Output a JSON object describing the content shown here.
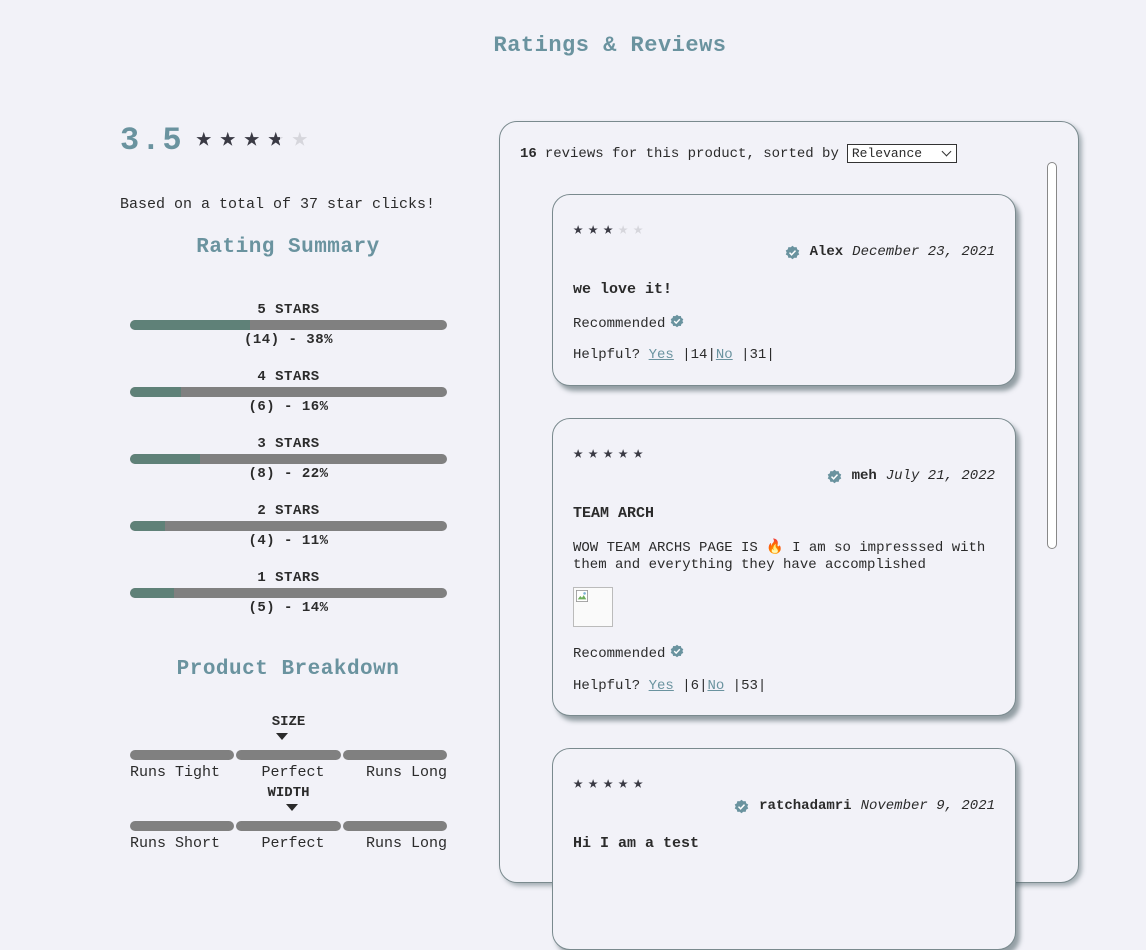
{
  "page": {
    "title": "Ratings & Reviews"
  },
  "summary": {
    "average": "3.5",
    "average_value": 3.5,
    "based_on": "Based on a total of 37 star clicks!",
    "title": "Rating Summary",
    "bars": [
      {
        "label": "5 STARS",
        "count": "(14) - 38%",
        "fraction": 0.38
      },
      {
        "label": "4 STARS",
        "count": "(6) - 16%",
        "fraction": 0.16
      },
      {
        "label": "3 STARS",
        "count": "(8) - 22%",
        "fraction": 0.22
      },
      {
        "label": "2 STARS",
        "count": "(4) - 11%",
        "fraction": 0.11
      },
      {
        "label": "1 STARS",
        "count": "(5) - 14%",
        "fraction": 0.14
      }
    ]
  },
  "breakdown": {
    "title": "Product Breakdown",
    "characteristics": [
      {
        "label": "SIZE",
        "low": "Runs Tight",
        "mid": "Perfect",
        "high": "Runs Long",
        "value": 0.48
      },
      {
        "label": "WIDTH",
        "low": "Runs Short",
        "mid": "Perfect",
        "high": "Runs Long",
        "value": 0.51
      }
    ]
  },
  "reviews": {
    "count": "16",
    "sort_text": "reviews for this product, sorted by",
    "sort_selected": "Relevance",
    "items": [
      {
        "rating": 3,
        "user": "Alex",
        "date": "December 23, 2021",
        "title": "we love it!",
        "body": "",
        "has_photo": false,
        "recommend": "Recommended",
        "helpful_label": "Helpful?",
        "yes_label": "Yes",
        "yes_count": "14",
        "no_label": "No",
        "no_count": "31"
      },
      {
        "rating": 5,
        "user": "meh",
        "date": "July 21, 2022",
        "title": "TEAM ARCH",
        "body": "WOW TEAM ARCHS PAGE IS 🔥 I am so impresssed with them and everything they have accomplished",
        "has_photo": true,
        "recommend": "Recommended",
        "helpful_label": "Helpful?",
        "yes_label": "Yes",
        "yes_count": "6",
        "no_label": "No",
        "no_count": "53"
      },
      {
        "rating": 5,
        "user": "ratchadamri",
        "date": "November 9, 2021",
        "title": "Hi I am a test",
        "body": "",
        "has_photo": false,
        "recommend": "",
        "helpful_label": "",
        "yes_label": "",
        "yes_count": "",
        "no_label": "",
        "no_count": ""
      }
    ]
  },
  "colors": {
    "accent": "#6a939f",
    "bar_fill": "#5f8178",
    "bar_track": "#808080",
    "star": "#3a3a44"
  },
  "icons": {
    "verified": "verified-check-icon",
    "star": "star-icon",
    "broken_image": "broken-image-icon"
  }
}
